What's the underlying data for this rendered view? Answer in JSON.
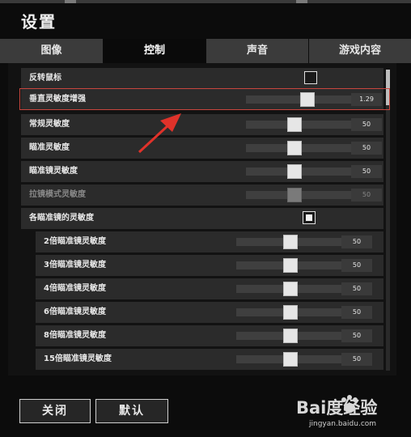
{
  "window": {
    "title": "设置"
  },
  "tabs": [
    {
      "label": "图像",
      "active": false
    },
    {
      "label": "控制",
      "active": true
    },
    {
      "label": "声音",
      "active": false
    },
    {
      "label": "游戏内容",
      "active": false
    }
  ],
  "settings": {
    "invert_mouse": {
      "label": "反转鼠标",
      "checked": false
    },
    "vertical_sensitivity": {
      "label": "垂直灵敏度增强",
      "value": "1.29",
      "level": 0.55
    },
    "general_sensitivity": {
      "label": "常规灵敏度",
      "value": "50",
      "level": 0.43
    },
    "aim_sensitivity": {
      "label": "瞄准灵敏度",
      "value": "50",
      "level": 0.43
    },
    "scope_sensitivity": {
      "label": "瞄准镜灵敏度",
      "value": "50",
      "level": 0.43
    },
    "zoom_sensitivity": {
      "label": "拉镜模式灵敏度",
      "value": "50",
      "level": 0.43,
      "disabled": true
    },
    "per_scope_sensitivity": {
      "label": "各瞄准镜的灵敏度",
      "checked": true
    },
    "scopes": [
      {
        "label": "2倍瞄准镜灵敏度",
        "value": "50",
        "level": 0.43
      },
      {
        "label": "3倍瞄准镜灵敏度",
        "value": "50",
        "level": 0.43
      },
      {
        "label": "4倍瞄准镜灵敏度",
        "value": "50",
        "level": 0.43
      },
      {
        "label": "6倍瞄准镜灵敏度",
        "value": "50",
        "level": 0.43
      },
      {
        "label": "8倍瞄准镜灵敏度",
        "value": "50",
        "level": 0.43
      },
      {
        "label": "15倍瞄准镜灵敏度",
        "value": "50",
        "level": 0.43
      }
    ]
  },
  "footer": {
    "close_label": "关闭",
    "default_label": "默认"
  },
  "watermark": {
    "text": "Bai度经验",
    "url": "jingyan.baidu.com"
  },
  "colors": {
    "highlight": "#c8463e",
    "arrow": "#e0322a"
  },
  "icons": [
    "scroll-thumb-icon",
    "annotation-arrow-icon",
    "paw-logo-icon"
  ]
}
